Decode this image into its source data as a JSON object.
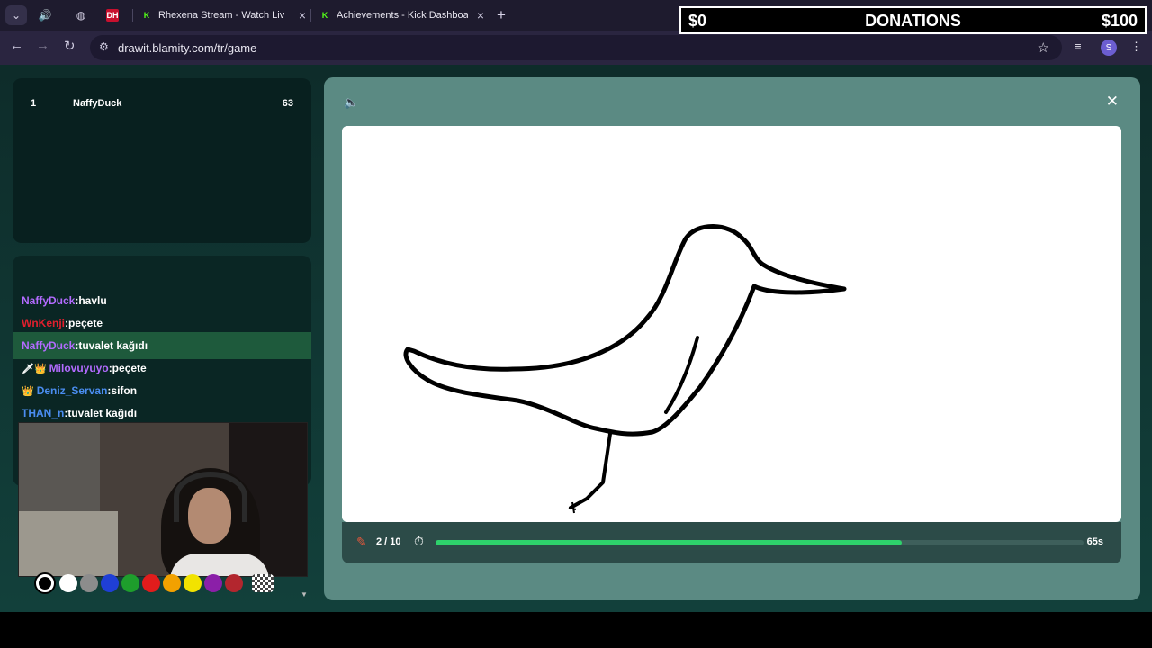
{
  "browser": {
    "tabs": [
      {
        "title": "Rhexena Stream - Watch Live o",
        "favicon": "K"
      },
      {
        "title": "Achievements - Kick Dashboard",
        "favicon": "K"
      }
    ],
    "pinned_favicon": "DH",
    "url": "drawit.blamity.com/tr/game",
    "profile_initial": "S"
  },
  "donations": {
    "min": "$0",
    "title": "DONATIONS",
    "max": "$100"
  },
  "leaderboard": [
    {
      "rank": "1",
      "name": "NaffyDuck",
      "score": "63"
    }
  ],
  "chat": [
    {
      "user": "NaffyDuck",
      "text": ":havlu",
      "color": "#b36bff",
      "badge": "",
      "highlight": false
    },
    {
      "user": "WnKenji",
      "text": ":peçete",
      "color": "#e0202e",
      "badge": "",
      "highlight": false
    },
    {
      "user": "NaffyDuck",
      "text": ":tuvalet kağıdı",
      "color": "#b36bff",
      "badge": "",
      "highlight": true
    },
    {
      "user": "Milovuyuyo",
      "text": ":peçete",
      "color": "#b36bff",
      "badge": "🗡👑",
      "highlight": false
    },
    {
      "user": "Deniz_Servan",
      "text": ":sifon",
      "color": "#4a8df0",
      "badge": "👑",
      "highlight": false
    },
    {
      "user": "THAN_n",
      "text": ":tuvalet kağıdı",
      "color": "#4a8df0",
      "badge": "",
      "highlight": false
    }
  ],
  "palette": [
    "#000000",
    "#ffffff",
    "#8c8c8c",
    "#1f3fd6",
    "#1e9e2c",
    "#e21c1c",
    "#f2a100",
    "#f2e300",
    "#8b1fa8",
    "#b3262e"
  ],
  "game": {
    "round": "2 / 10",
    "seconds_left": "65s",
    "progress_fraction": 0.72
  },
  "colors": {
    "accent": "#2ed16b",
    "panel": "#5b8a83"
  }
}
